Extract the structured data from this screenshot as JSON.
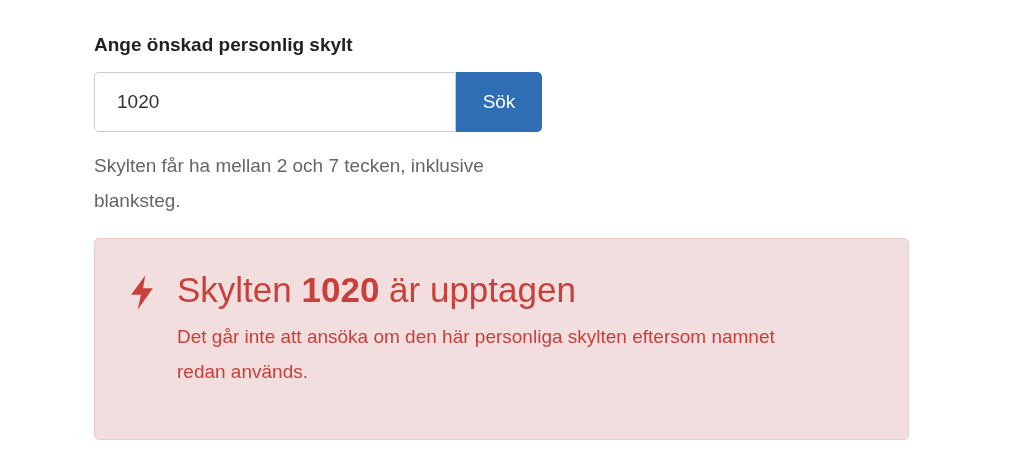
{
  "plate_search": {
    "label": "Ange önskad personlig skylt",
    "value": "1020",
    "button": "Sök",
    "help": "Skylten får ha mellan 2 och 7 tecken, inklusive blanksteg."
  },
  "alert": {
    "kind": "error",
    "title": "Skylten **1020** är upptagen",
    "message": "Det går inte att ansöka om den här personliga skylten eftersom namnet redan används."
  }
}
